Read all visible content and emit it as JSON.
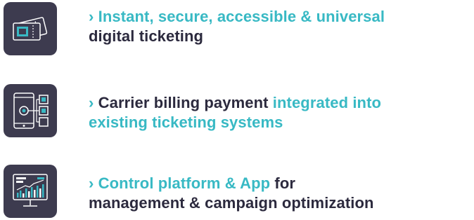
{
  "colors": {
    "accent": "#38b9c4",
    "text": "#2c2a3e",
    "tile_background": "#3d3b4f"
  },
  "features": [
    {
      "icon": "ticket-icon",
      "line1": [
        {
          "text": "› Instant, secure, accessible & universal",
          "style": "accent"
        }
      ],
      "line2": [
        {
          "text": "digital ticketing",
          "style": "dark"
        }
      ]
    },
    {
      "icon": "mobile-payment-icon",
      "line1": [
        {
          "text": "›",
          "style": "accent"
        },
        {
          "text": " Carrier billing payment ",
          "style": "dark"
        },
        {
          "text": "integrated into",
          "style": "accent"
        }
      ],
      "line2": [
        {
          "text": "existing ticketing systems",
          "style": "accent"
        }
      ]
    },
    {
      "icon": "analytics-monitor-icon",
      "line1": [
        {
          "text": "› Control platform & App",
          "style": "accent"
        },
        {
          "text": " for",
          "style": "dark"
        }
      ],
      "line2": [
        {
          "text": "management & campaign optimization",
          "style": "dark"
        }
      ]
    }
  ]
}
